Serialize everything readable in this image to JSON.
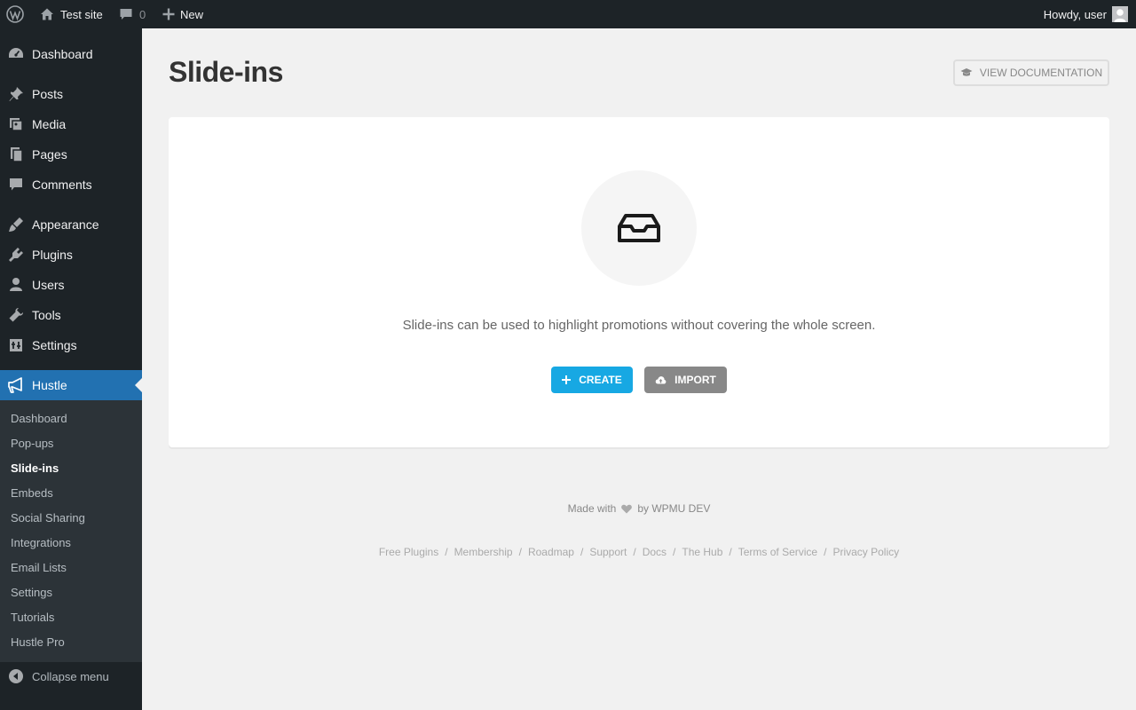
{
  "admin_bar": {
    "site_name": "Test site",
    "comments_count": "0",
    "new_label": "New",
    "howdy": "Howdy, user"
  },
  "sidebar": {
    "items": [
      {
        "label": "Dashboard",
        "icon": "dashboard-icon"
      },
      {
        "label": "Posts",
        "icon": "pin-icon"
      },
      {
        "label": "Media",
        "icon": "media-icon"
      },
      {
        "label": "Pages",
        "icon": "pages-icon"
      },
      {
        "label": "Comments",
        "icon": "comments-icon"
      },
      {
        "label": "Appearance",
        "icon": "brush-icon"
      },
      {
        "label": "Plugins",
        "icon": "plugin-icon"
      },
      {
        "label": "Users",
        "icon": "users-icon"
      },
      {
        "label": "Tools",
        "icon": "wrench-icon"
      },
      {
        "label": "Settings",
        "icon": "settings-icon"
      },
      {
        "label": "Hustle",
        "icon": "megaphone-icon"
      }
    ],
    "submenu": [
      "Dashboard",
      "Pop-ups",
      "Slide-ins",
      "Embeds",
      "Social Sharing",
      "Integrations",
      "Email Lists",
      "Settings",
      "Tutorials",
      "Hustle Pro"
    ],
    "collapse_label": "Collapse menu"
  },
  "main": {
    "title": "Slide-ins",
    "doc_button": "View Documentation",
    "empty_text": "Slide-ins can be used to highlight promotions without covering the whole screen.",
    "create_label": "Create",
    "import_label": "Import"
  },
  "footer": {
    "made_with": "Made with",
    "by": "by WPMU DEV",
    "links": [
      "Free Plugins",
      "Membership",
      "Roadmap",
      "Support",
      "Docs",
      "The Hub",
      "Terms of Service",
      "Privacy Policy"
    ]
  },
  "colors": {
    "admin_dark": "#1d2327",
    "accent_blue": "#2271b1",
    "create_blue": "#17a8e3",
    "import_gray": "#888888"
  }
}
